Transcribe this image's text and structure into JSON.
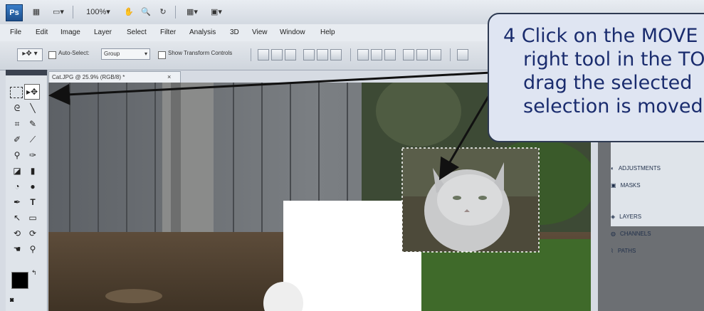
{
  "toolbar": {
    "logo": "Ps",
    "zoom_value": "100%"
  },
  "menu": {
    "items": [
      "File",
      "Edit",
      "Image",
      "Layer",
      "Select",
      "Filter",
      "Analysis",
      "3D",
      "View",
      "Window",
      "Help"
    ]
  },
  "options": {
    "auto_select_label": "Auto-Select:",
    "auto_select_value": "Group",
    "show_transform_label": "Show Transform Controls"
  },
  "document": {
    "tab_title": "Cat.JPG @ 25.9% (RGB/8) *"
  },
  "panels": {
    "items": [
      "ADJUSTMENTS",
      "MASKS",
      "LAYERS",
      "CHANNELS",
      "PATHS"
    ]
  },
  "callout": {
    "lines": [
      "4  Click on the MOVE",
      "right tool in the TO",
      "drag the selected",
      "selection is moved"
    ]
  },
  "colors": {
    "callout_bg": "#dfe5f2",
    "callout_text": "#1a2c6e",
    "arrow": "#111111"
  }
}
